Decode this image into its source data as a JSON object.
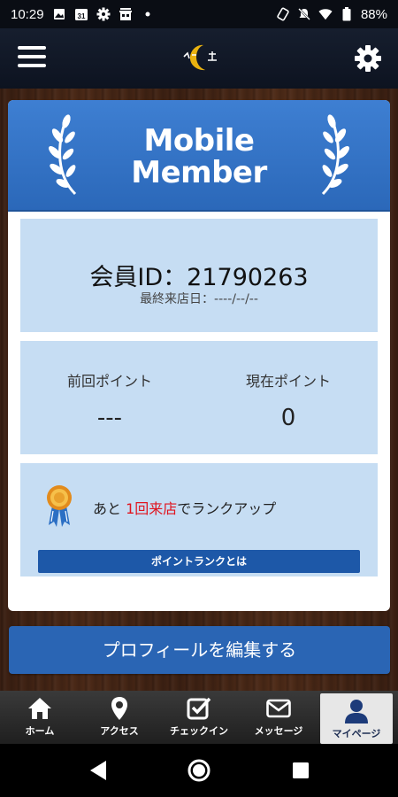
{
  "status_bar": {
    "time": "10:29",
    "calendar_day": "31",
    "battery": "88%"
  },
  "card": {
    "title_line1": "Mobile",
    "title_line2": "Member",
    "member_id_label": "会員ID：21790263",
    "last_visit_label": "最終来店日：----/--/--",
    "prev_points_label": "前回ポイント",
    "prev_points_value": "---",
    "current_points_label": "現在ポイント",
    "current_points_value": "0",
    "rank_prefix": "あと ",
    "rank_highlight": "1回来店",
    "rank_suffix": "でランクアップ",
    "rank_button_label": "ポイントランクとは"
  },
  "edit_profile_label": "プロフィールを編集する",
  "bottom_nav": {
    "items": [
      {
        "label": "ホーム",
        "icon": "home-icon"
      },
      {
        "label": "アクセス",
        "icon": "map-pin-icon"
      },
      {
        "label": "チェックイン",
        "icon": "checkbox-icon"
      },
      {
        "label": "メッセージ",
        "icon": "envelope-icon"
      },
      {
        "label": "マイページ",
        "icon": "person-icon",
        "active": true
      }
    ]
  },
  "colors": {
    "header_blue": "#2b68b9",
    "panel_blue": "#c6ddf3",
    "button_blue": "#2a65b4",
    "highlight_red": "#e0141e"
  }
}
